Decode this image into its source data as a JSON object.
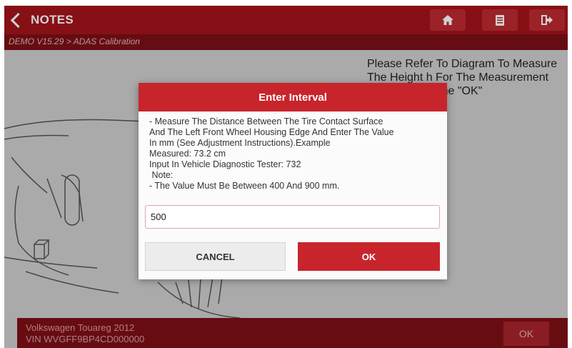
{
  "header": {
    "back_label": "NOTES",
    "buttons": [
      {
        "name": "home-button",
        "icon": "home-icon"
      },
      {
        "name": "print-button",
        "icon": "printer-icon"
      },
      {
        "name": "exit-button",
        "icon": "exit-icon"
      }
    ]
  },
  "breadcrumb": "DEMO V15.29 > ADAS Calibration",
  "instruction": "Please Refer To Diagram To Measure The Height h For The Measurement Steps, Press The \"OK\"",
  "dialog": {
    "title": "Enter Interval",
    "lines": [
      "- Measure The Distance Between The Tire Contact Surface",
      "And The Left Front Wheel Housing Edge And Enter The Value",
      "In mm (See Adjustment Instructions).Example",
      "Measured: 73.2 cm",
      "Input In Vehicle Diagnostic Tester: 732",
      " Note:",
      "- The Value Must Be Between 400 And 900 mm."
    ],
    "input_value": "500",
    "cancel_label": "CANCEL",
    "ok_label": "OK"
  },
  "footer": {
    "vehicle_line1": "Volkswagen Touareg 2012",
    "vehicle_line2": "VIN WVGFF9BP4CD000000",
    "ok_label": "OK"
  },
  "colors": {
    "brand_red": "#c8242c",
    "topbar": "#a5141d",
    "footer": "#7e1017"
  }
}
